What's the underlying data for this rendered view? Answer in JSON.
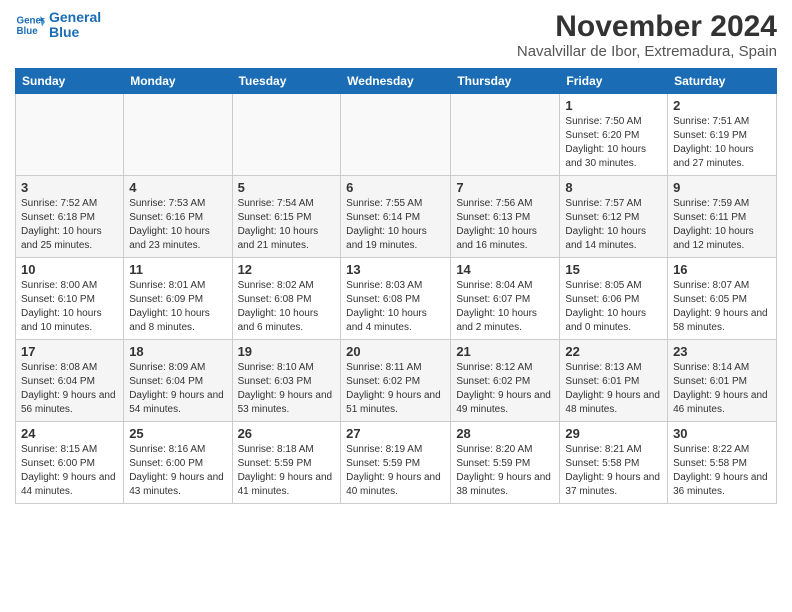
{
  "logo": {
    "line1": "General",
    "line2": "Blue"
  },
  "title": "November 2024",
  "subtitle": "Navalvillar de Ibor, Extremadura, Spain",
  "weekdays": [
    "Sunday",
    "Monday",
    "Tuesday",
    "Wednesday",
    "Thursday",
    "Friday",
    "Saturday"
  ],
  "weeks": [
    [
      {
        "day": "",
        "info": ""
      },
      {
        "day": "",
        "info": ""
      },
      {
        "day": "",
        "info": ""
      },
      {
        "day": "",
        "info": ""
      },
      {
        "day": "",
        "info": ""
      },
      {
        "day": "1",
        "info": "Sunrise: 7:50 AM\nSunset: 6:20 PM\nDaylight: 10 hours and 30 minutes."
      },
      {
        "day": "2",
        "info": "Sunrise: 7:51 AM\nSunset: 6:19 PM\nDaylight: 10 hours and 27 minutes."
      }
    ],
    [
      {
        "day": "3",
        "info": "Sunrise: 7:52 AM\nSunset: 6:18 PM\nDaylight: 10 hours and 25 minutes."
      },
      {
        "day": "4",
        "info": "Sunrise: 7:53 AM\nSunset: 6:16 PM\nDaylight: 10 hours and 23 minutes."
      },
      {
        "day": "5",
        "info": "Sunrise: 7:54 AM\nSunset: 6:15 PM\nDaylight: 10 hours and 21 minutes."
      },
      {
        "day": "6",
        "info": "Sunrise: 7:55 AM\nSunset: 6:14 PM\nDaylight: 10 hours and 19 minutes."
      },
      {
        "day": "7",
        "info": "Sunrise: 7:56 AM\nSunset: 6:13 PM\nDaylight: 10 hours and 16 minutes."
      },
      {
        "day": "8",
        "info": "Sunrise: 7:57 AM\nSunset: 6:12 PM\nDaylight: 10 hours and 14 minutes."
      },
      {
        "day": "9",
        "info": "Sunrise: 7:59 AM\nSunset: 6:11 PM\nDaylight: 10 hours and 12 minutes."
      }
    ],
    [
      {
        "day": "10",
        "info": "Sunrise: 8:00 AM\nSunset: 6:10 PM\nDaylight: 10 hours and 10 minutes."
      },
      {
        "day": "11",
        "info": "Sunrise: 8:01 AM\nSunset: 6:09 PM\nDaylight: 10 hours and 8 minutes."
      },
      {
        "day": "12",
        "info": "Sunrise: 8:02 AM\nSunset: 6:08 PM\nDaylight: 10 hours and 6 minutes."
      },
      {
        "day": "13",
        "info": "Sunrise: 8:03 AM\nSunset: 6:08 PM\nDaylight: 10 hours and 4 minutes."
      },
      {
        "day": "14",
        "info": "Sunrise: 8:04 AM\nSunset: 6:07 PM\nDaylight: 10 hours and 2 minutes."
      },
      {
        "day": "15",
        "info": "Sunrise: 8:05 AM\nSunset: 6:06 PM\nDaylight: 10 hours and 0 minutes."
      },
      {
        "day": "16",
        "info": "Sunrise: 8:07 AM\nSunset: 6:05 PM\nDaylight: 9 hours and 58 minutes."
      }
    ],
    [
      {
        "day": "17",
        "info": "Sunrise: 8:08 AM\nSunset: 6:04 PM\nDaylight: 9 hours and 56 minutes."
      },
      {
        "day": "18",
        "info": "Sunrise: 8:09 AM\nSunset: 6:04 PM\nDaylight: 9 hours and 54 minutes."
      },
      {
        "day": "19",
        "info": "Sunrise: 8:10 AM\nSunset: 6:03 PM\nDaylight: 9 hours and 53 minutes."
      },
      {
        "day": "20",
        "info": "Sunrise: 8:11 AM\nSunset: 6:02 PM\nDaylight: 9 hours and 51 minutes."
      },
      {
        "day": "21",
        "info": "Sunrise: 8:12 AM\nSunset: 6:02 PM\nDaylight: 9 hours and 49 minutes."
      },
      {
        "day": "22",
        "info": "Sunrise: 8:13 AM\nSunset: 6:01 PM\nDaylight: 9 hours and 48 minutes."
      },
      {
        "day": "23",
        "info": "Sunrise: 8:14 AM\nSunset: 6:01 PM\nDaylight: 9 hours and 46 minutes."
      }
    ],
    [
      {
        "day": "24",
        "info": "Sunrise: 8:15 AM\nSunset: 6:00 PM\nDaylight: 9 hours and 44 minutes."
      },
      {
        "day": "25",
        "info": "Sunrise: 8:16 AM\nSunset: 6:00 PM\nDaylight: 9 hours and 43 minutes."
      },
      {
        "day": "26",
        "info": "Sunrise: 8:18 AM\nSunset: 5:59 PM\nDaylight: 9 hours and 41 minutes."
      },
      {
        "day": "27",
        "info": "Sunrise: 8:19 AM\nSunset: 5:59 PM\nDaylight: 9 hours and 40 minutes."
      },
      {
        "day": "28",
        "info": "Sunrise: 8:20 AM\nSunset: 5:59 PM\nDaylight: 9 hours and 38 minutes."
      },
      {
        "day": "29",
        "info": "Sunrise: 8:21 AM\nSunset: 5:58 PM\nDaylight: 9 hours and 37 minutes."
      },
      {
        "day": "30",
        "info": "Sunrise: 8:22 AM\nSunset: 5:58 PM\nDaylight: 9 hours and 36 minutes."
      }
    ]
  ]
}
